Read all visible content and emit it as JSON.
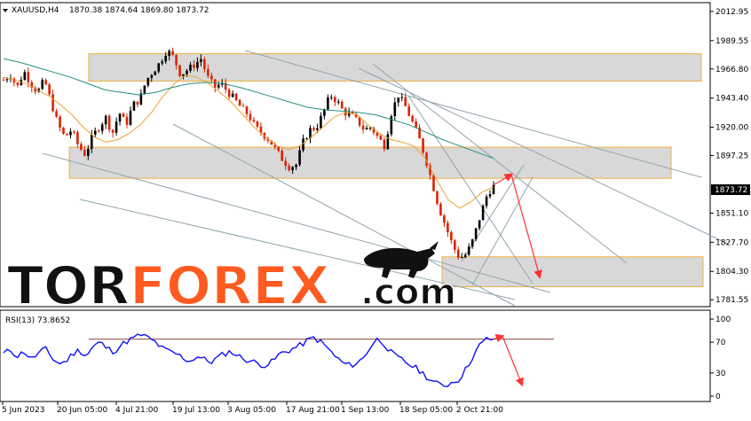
{
  "chart_data": [
    {
      "type": "candlestick",
      "symbol_header": "XAUUSD,H4",
      "ohlc_header": "1870.38 1874.64 1869.80 1873.72",
      "current_price_label": "1873.72",
      "ylim": [
        1776,
        2020
      ],
      "price_ticks": [
        "2012.95",
        "1989.55",
        "1966.80",
        "1943.40",
        "1920.00",
        "1897.25",
        "1873.72",
        "1851.10",
        "1827.70",
        "1804.30",
        "1781.55"
      ],
      "time_ticks": [
        "5 Jun 2023",
        "20 Jun 05:00",
        "4 Jul 21:00",
        "19 Jul 13:00",
        "3 Aug 05:00",
        "17 Aug 21:00",
        "1 Sep 13:00",
        "18 Sep 05:00",
        "2 Oct 21:00"
      ],
      "close_path": [
        1958,
        1962,
        1952,
        1965,
        1955,
        1948,
        1958,
        1940,
        1922,
        1912,
        1918,
        1905,
        1898,
        1912,
        1920,
        1928,
        1915,
        1932,
        1922,
        1938,
        1942,
        1958,
        1965,
        1972,
        1982,
        1976,
        1962,
        1966,
        1970,
        1975,
        1960,
        1952,
        1955,
        1948,
        1942,
        1935,
        1930,
        1920,
        1915,
        1910,
        1902,
        1894,
        1888,
        1890,
        1908,
        1918,
        1920,
        1932,
        1946,
        1941,
        1932,
        1930,
        1925,
        1918,
        1920,
        1912,
        1905,
        1932,
        1946,
        1937,
        1925,
        1912,
        1895,
        1875,
        1855,
        1840,
        1825,
        1815,
        1818,
        1830,
        1848,
        1865,
        1873.72
      ],
      "ma_fast": [
        1960,
        1958,
        1955,
        1950,
        1945,
        1938,
        1930,
        1920,
        1912,
        1908,
        1910,
        1915,
        1922,
        1932,
        1945,
        1955,
        1962,
        1960,
        1955,
        1948,
        1940,
        1930,
        1920,
        1912,
        1905,
        1902,
        1905,
        1912,
        1920,
        1928,
        1932,
        1930,
        1922,
        1915,
        1910,
        1908,
        1905,
        1895,
        1878,
        1862,
        1855,
        1860,
        1868,
        1872
      ],
      "ma_slow": [
        1975,
        1972,
        1968,
        1964,
        1960,
        1955,
        1950,
        1948,
        1946,
        1948,
        1952,
        1955,
        1956,
        1955,
        1952,
        1948,
        1944,
        1940,
        1936,
        1934,
        1933,
        1932,
        1930,
        1926,
        1922,
        1916,
        1910,
        1905,
        1900,
        1895
      ],
      "zones": [
        {
          "label": "resistance-zone-upper",
          "y1": 1979,
          "y2": 1957
        },
        {
          "label": "resistance-zone-middle",
          "y1": 1904,
          "y2": 1879
        },
        {
          "label": "support-zone-lower",
          "y1": 1816,
          "y2": 1792
        }
      ],
      "forecast": [
        {
          "from_price": 1873.72,
          "to_price": 1882
        },
        {
          "from_price": 1882,
          "to_price": 1800
        }
      ]
    },
    {
      "type": "line",
      "label": "RSI(13) 73.8652",
      "ylim": [
        0,
        100
      ],
      "ticks": [
        "100",
        "70",
        "30",
        "0"
      ],
      "level_line": 74,
      "values": [
        55,
        60,
        52,
        58,
        48,
        55,
        62,
        50,
        42,
        45,
        55,
        60,
        52,
        65,
        70,
        62,
        58,
        66,
        72,
        76,
        80,
        75,
        70,
        62,
        58,
        55,
        50,
        45,
        52,
        48,
        44,
        50,
        55,
        58,
        52,
        48,
        45,
        42,
        40,
        45,
        55,
        58,
        62,
        66,
        72,
        76,
        70,
        62,
        52,
        44,
        40,
        42,
        48,
        62,
        74,
        70,
        58,
        50,
        46,
        40,
        35,
        28,
        20,
        15,
        14,
        18,
        22,
        35,
        52,
        66,
        74,
        73.8652
      ],
      "forecast": [
        {
          "from": 74,
          "to": 78
        },
        {
          "from": 78,
          "to": 15
        }
      ]
    }
  ],
  "watermark": {
    "brand_left": "TOR",
    "brand_right": "FOREX",
    "suffix": ".com"
  },
  "colors": {
    "candle_up": "#000000",
    "candle_down": "#dd2200",
    "ma_fast": "#f0a030",
    "ma_slow": "#209080",
    "rsi": "#1010ff",
    "zone_fill": "#d8d8d8",
    "zone_border": "#f0b040",
    "channel_lines": "#90a4ae",
    "arrows": "#ff3030",
    "brand_dark": "#111111",
    "brand_orange": "#ff5a1f"
  }
}
